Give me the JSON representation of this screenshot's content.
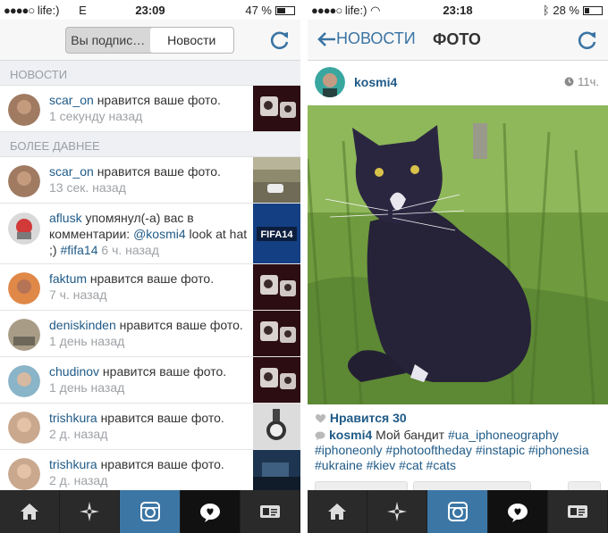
{
  "left": {
    "status": {
      "carrier": "life:)",
      "network": "E",
      "time": "23:09",
      "battery": "47 %",
      "battery_level": 0.47
    },
    "segments": [
      {
        "label": "Вы подпис…",
        "active": false
      },
      {
        "label": "Новости",
        "active": true
      }
    ],
    "sections": {
      "new": "НОВОСТИ",
      "older": "БОЛЕЕ ДАВНЕЕ"
    },
    "news_rows": [
      {
        "user": "scar_on",
        "action": " нравится ваше фото.",
        "time": "1 секунду назад"
      }
    ],
    "older_rows": [
      {
        "user": "scar_on",
        "action": " нравится ваше фото.",
        "time": "13 сек. назад"
      },
      {
        "user": "aflusk",
        "action": " упомянул(-а) вас в комментарии: ",
        "mention": "@kosmi4",
        "rest": " look at hat ;) ",
        "hashtag": "#fifa14",
        "time": " 6 ч. назад",
        "thumb_text": "FIFA14"
      },
      {
        "user": "faktum",
        "action": " нравится ваше фото.",
        "time": "7 ч. назад"
      },
      {
        "user": "deniskinden",
        "action": " нравится ваше фото.",
        "time": "1 день назад"
      },
      {
        "user": "chudinov",
        "action": " нравится ваше фото.",
        "time": "1 день назад"
      },
      {
        "user": "trishkura",
        "action": " нравится ваше фото.",
        "time": "2 д. назад"
      },
      {
        "user": "trishkura",
        "action": " нравится ваше фото.",
        "time": "2 д. назад"
      }
    ]
  },
  "right": {
    "status": {
      "carrier": "life:)",
      "time": "23:18",
      "battery": "28 %",
      "battery_level": 0.28
    },
    "nav": {
      "back_label": "НОВОСТИ",
      "title": "ФОТО"
    },
    "post": {
      "user": "kosmi4",
      "age": "11ч.",
      "likes": "Нравится 30",
      "caption_user": "kosmi4",
      "caption_text": " Мой бандит ",
      "hashtags": [
        "#ua_iphoneography",
        "#iphoneonly",
        "#photooftheday",
        "#instapic",
        "#iphonesia",
        "#ukraine",
        "#kiev",
        "#cat",
        "#cats"
      ]
    }
  },
  "tabs": [
    "home-icon",
    "explore-icon",
    "camera-icon",
    "activity-icon",
    "profile-icon"
  ],
  "colors": {
    "link": "#1f5a87",
    "accent": "#3c76a5",
    "tabbar": "#2a2a2a"
  }
}
